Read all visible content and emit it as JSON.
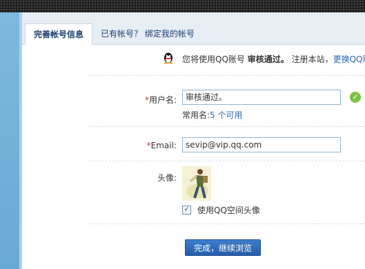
{
  "tabs": [
    {
      "label": "完善帐号信息"
    },
    {
      "label": "已有帐号？ 绑定我的帐号"
    }
  ],
  "notice": {
    "prefix": "您将使用QQ账号",
    "account": "审核通过。",
    "mid": "注册本站，",
    "link": "更换QQ账"
  },
  "form": {
    "username": {
      "required": "*",
      "label": "用户名:",
      "value": "审核通过。",
      "hint_prefix": "常用名:",
      "hint_link": "5 个可用"
    },
    "email": {
      "required": "*",
      "label": "Email:",
      "value": "sevip@vip.qq.com"
    },
    "avatar": {
      "label": "头像:",
      "checkbox_label": "使用QQ空间头像",
      "checked": true
    },
    "submit_label": "完成，继续浏览"
  },
  "colors": {
    "accent": "#2a65b0",
    "required": "#c0392b",
    "ok": "#7cc243"
  }
}
